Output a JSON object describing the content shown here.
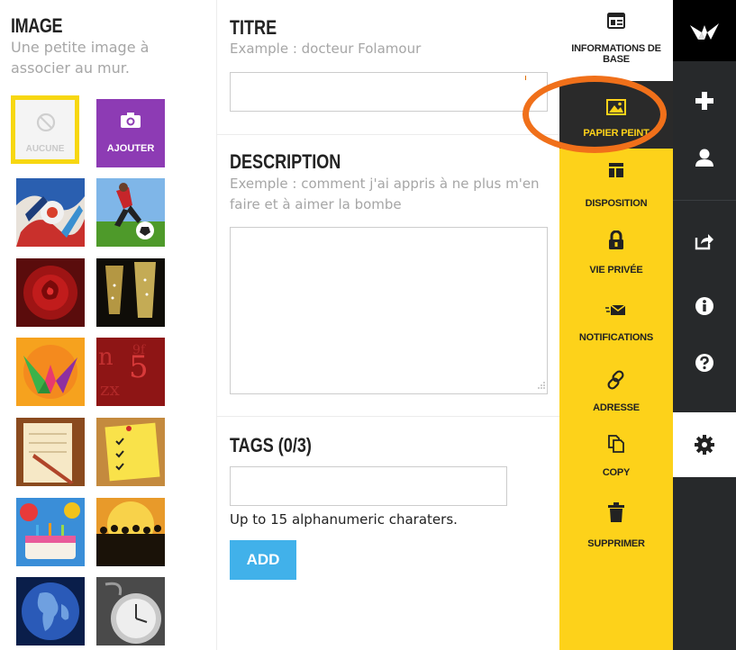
{
  "image_section": {
    "title": "IMAGE",
    "help": "Une petite image à associer au mur.",
    "none_label": "AUCUNE",
    "add_label": "AJOUTER"
  },
  "title_section": {
    "title": "TITRE",
    "help": "Example : docteur Folamour",
    "value": ""
  },
  "description_section": {
    "title": "DESCRIPTION",
    "help": "Exemple : comment j'ai appris à ne plus m'en faire et à aimer la bombe",
    "value": ""
  },
  "tags_section": {
    "title": "TAGS (0/3)",
    "value": "",
    "hint": "Up to 15 alphanumeric charaters.",
    "add_label": "ADD"
  },
  "settings_menu": {
    "items": [
      {
        "label": "INFORMATIONS DE BASE",
        "icon": "info-card-icon"
      },
      {
        "label": "PAPIER PEINT",
        "icon": "image-icon"
      },
      {
        "label": "DISPOSITION",
        "icon": "layout-icon"
      },
      {
        "label": "VIE PRIVÉE",
        "icon": "lock-icon"
      },
      {
        "label": "NOTIFICATIONS",
        "icon": "envelope-icon"
      },
      {
        "label": "ADRESSE",
        "icon": "link-icon"
      },
      {
        "label": "COPY",
        "icon": "copy-icon"
      },
      {
        "label": "SUPPRIMER",
        "icon": "trash-icon"
      }
    ],
    "active": "PAPIER PEINT"
  },
  "sidebar": {
    "icons": [
      "padlet-logo-icon",
      "plus-icon",
      "user-icon",
      "share-icon",
      "info-icon",
      "help-icon",
      "gear-icon"
    ]
  },
  "colors": {
    "menu_yellow": "#fdd21a",
    "sidebar_dark": "#27292b",
    "add_purple": "#8d3bb4",
    "button_blue": "#41b1ea",
    "highlight_orange": "#f0701a"
  }
}
